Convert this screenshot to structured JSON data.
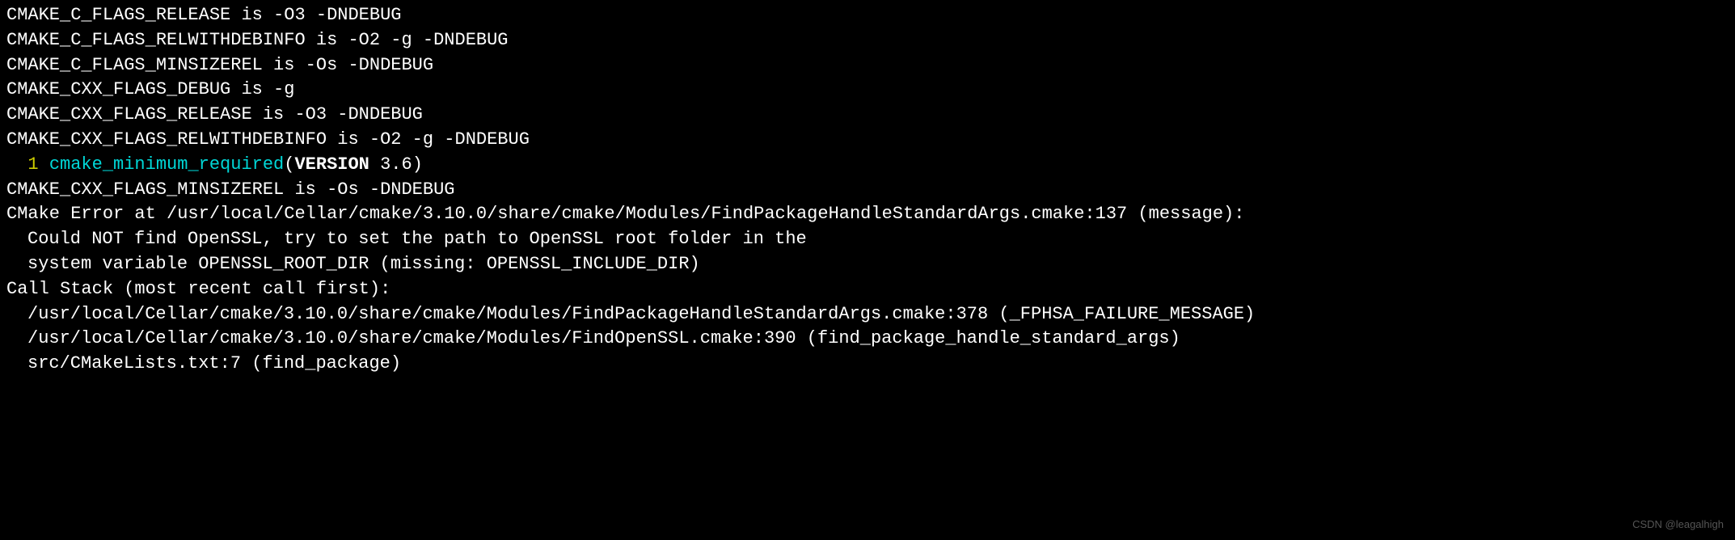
{
  "lines": {
    "l1": "CMAKE_C_FLAGS_RELEASE is -O3 -DNDEBUG",
    "l2": "CMAKE_C_FLAGS_RELWITHDEBINFO is -O2 -g -DNDEBUG",
    "l3": "CMAKE_C_FLAGS_MINSIZEREL is -Os -DNDEBUG",
    "l4": "CMAKE_CXX_FLAGS_DEBUG is -g",
    "l5": "CMAKE_CXX_FLAGS_RELEASE is -O3 -DNDEBUG",
    "l6": "CMAKE_CXX_FLAGS_RELWITHDEBINFO is -O2 -g -DNDEBUG",
    "l7_num": "  1 ",
    "l7_func": "cmake_minimum_required",
    "l7_open": "(",
    "l7_kw": "VERSION",
    "l7_rest": " 3.6)",
    "l8": "CMAKE_CXX_FLAGS_MINSIZEREL is -Os -DNDEBUG",
    "l9": "CMake Error at /usr/local/Cellar/cmake/3.10.0/share/cmake/Modules/FindPackageHandleStandardArgs.cmake:137 (message):",
    "l10": "Could NOT find OpenSSL, try to set the path to OpenSSL root folder in the",
    "l11": "system variable OPENSSL_ROOT_DIR (missing: OPENSSL_INCLUDE_DIR)",
    "l12": "Call Stack (most recent call first):",
    "l13": "/usr/local/Cellar/cmake/3.10.0/share/cmake/Modules/FindPackageHandleStandardArgs.cmake:378 (_FPHSA_FAILURE_MESSAGE)",
    "l14": "/usr/local/Cellar/cmake/3.10.0/share/cmake/Modules/FindOpenSSL.cmake:390 (find_package_handle_standard_args)",
    "l15": "src/CMakeLists.txt:7 (find_package)"
  },
  "watermark": "CSDN @leagalhigh"
}
